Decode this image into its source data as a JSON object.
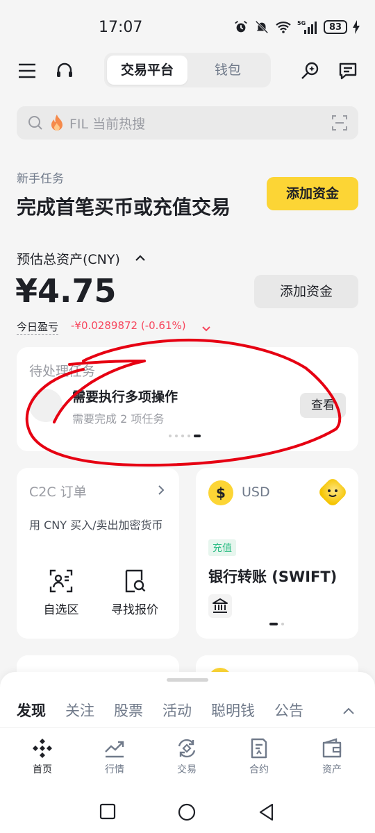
{
  "status_bar": {
    "time": "17:07",
    "network": "5G",
    "battery": "83"
  },
  "header": {
    "tabs": [
      "交易平台",
      "钱包"
    ],
    "active_tab": 0
  },
  "search": {
    "placeholder": "FIL 当前热搜"
  },
  "task_banner": {
    "label": "新手任务",
    "title": "完成首笔买币或充值交易",
    "button": "添加资金"
  },
  "balance": {
    "label": "预估总资产(CNY)",
    "value": "¥4.75",
    "button": "添加资金",
    "pnl_label": "今日盈亏",
    "pnl_value": "-¥0.0289872 (-0.61%)"
  },
  "pending": {
    "title": "待处理任务",
    "main": "需要执行多项操作",
    "sub": "需要完成 2 项任务",
    "button": "查看",
    "pages": 5,
    "active_page": 4
  },
  "c2c": {
    "title": "C2C 订单",
    "desc": "用 CNY 买入/卖出加密货币",
    "actions": [
      {
        "label": "自选区",
        "icon": "user-scan-icon"
      },
      {
        "label": "寻找报价",
        "icon": "search-document-icon"
      }
    ]
  },
  "usd_card": {
    "currency": "USD",
    "coin_symbol": "$",
    "tag": "充值",
    "method": "银行转账 (SWIFT)",
    "icon": "bank-icon"
  },
  "sheet_tabs": [
    "发现",
    "关注",
    "股票",
    "活动",
    "聪明钱",
    "公告"
  ],
  "bottom_nav": [
    {
      "label": "首页",
      "icon": "home-diamond-icon",
      "active": true
    },
    {
      "label": "行情",
      "icon": "market-chart-icon",
      "active": false
    },
    {
      "label": "交易",
      "icon": "trade-swap-icon",
      "active": false
    },
    {
      "label": "合约",
      "icon": "contract-document-icon",
      "active": false
    },
    {
      "label": "资产",
      "icon": "wallet-icon",
      "active": false
    }
  ],
  "colors": {
    "brand_yellow": "#fcd535",
    "down_red": "#f6465d",
    "up_green": "#2ebd85",
    "scribble_red": "#e60012"
  }
}
